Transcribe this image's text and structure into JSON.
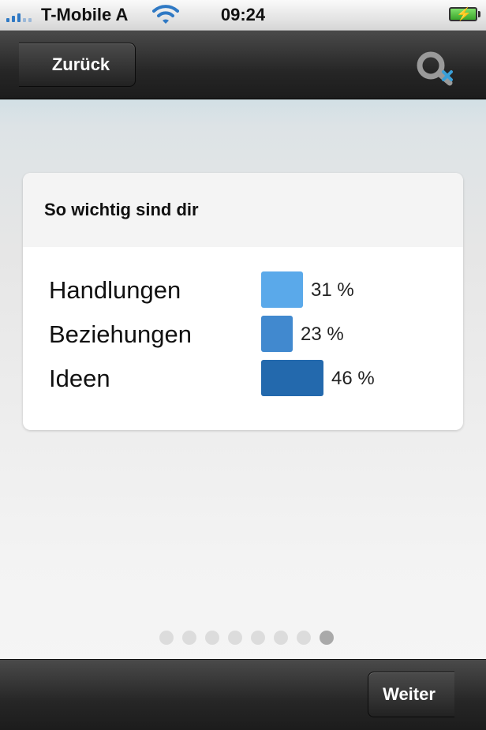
{
  "status_bar": {
    "carrier": "T-Mobile A",
    "time": "09:24"
  },
  "nav": {
    "back_label": "Zurück",
    "logo_icon": "app-logo-icon"
  },
  "card": {
    "title": "So wichtig sind dir",
    "rows": [
      {
        "label": "Handlungen",
        "percent": 31,
        "value_label": "31 %",
        "color": "#5aa9ea"
      },
      {
        "label": "Beziehungen",
        "percent": 23,
        "value_label": "23 %",
        "color": "#4189cf"
      },
      {
        "label": "Ideen",
        "percent": 46,
        "value_label": "46 %",
        "color": "#2369ad"
      }
    ]
  },
  "pager": {
    "page_count": 8,
    "current_page": 8
  },
  "toolbar": {
    "next_label": "Weiter"
  }
}
